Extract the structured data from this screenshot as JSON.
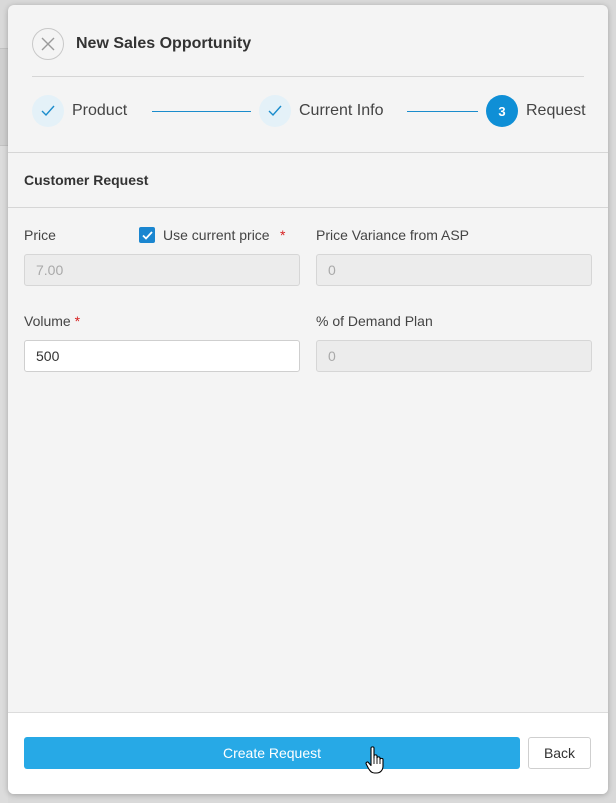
{
  "dialog": {
    "title": "New Sales Opportunity",
    "close_icon": "close-icon"
  },
  "stepper": {
    "steps": [
      {
        "label": "Product",
        "state": "complete"
      },
      {
        "label": "Current Info",
        "state": "complete"
      },
      {
        "label": "Request",
        "state": "active",
        "number": "3"
      }
    ],
    "accent_color": "#0f8fd6"
  },
  "section": {
    "title": "Customer Request"
  },
  "form": {
    "price": {
      "label": "Price",
      "value": "7.00",
      "use_current_label": "Use current price",
      "use_current_checked": true,
      "required_mark": "*"
    },
    "price_variance": {
      "label": "Price Variance from ASP",
      "value": "0"
    },
    "volume": {
      "label": "Volume",
      "required_mark": "*",
      "value": "500"
    },
    "demand_plan": {
      "label": "% of Demand Plan",
      "value": "0"
    }
  },
  "footer": {
    "create_label": "Create Request",
    "back_label": "Back",
    "primary_color": "#27a9e6"
  }
}
